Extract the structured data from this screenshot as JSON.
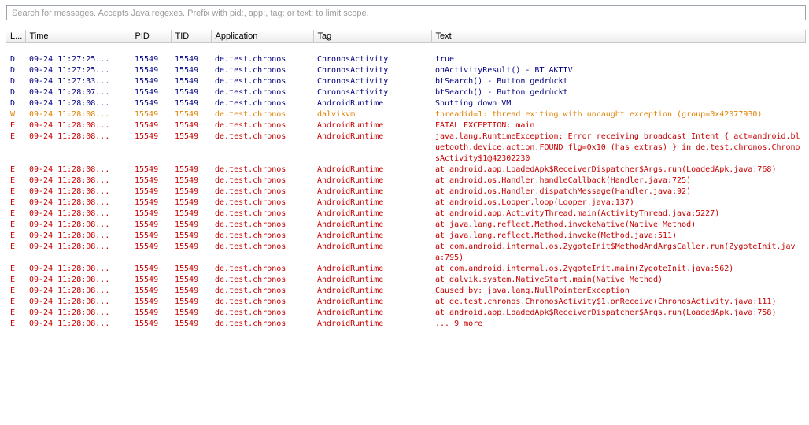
{
  "search": {
    "placeholder": "Search for messages. Accepts Java regexes. Prefix with pid:, app:, tag: or text: to limit scope."
  },
  "columns": {
    "level": "L...",
    "time": "Time",
    "pid": "PID",
    "tid": "TID",
    "application": "Application",
    "tag": "Tag",
    "text": "Text"
  },
  "colors": {
    "debug": "#000080",
    "warn": "#e08000",
    "error": "#c80000"
  },
  "rows": [
    {
      "level": "D",
      "time": "09-24 11:27:25...",
      "pid": "15549",
      "tid": "15549",
      "app": "de.test.chronos",
      "tag": "ChronosActivity",
      "text": "true"
    },
    {
      "level": "D",
      "time": "09-24 11:27:25...",
      "pid": "15549",
      "tid": "15549",
      "app": "de.test.chronos",
      "tag": "ChronosActivity",
      "text": "onActivityResult() - BT AKTIV"
    },
    {
      "level": "D",
      "time": "09-24 11:27:33...",
      "pid": "15549",
      "tid": "15549",
      "app": "de.test.chronos",
      "tag": "ChronosActivity",
      "text": "btSearch() - Button gedrückt"
    },
    {
      "level": "D",
      "time": "09-24 11:28:07...",
      "pid": "15549",
      "tid": "15549",
      "app": "de.test.chronos",
      "tag": "ChronosActivity",
      "text": "btSearch() - Button gedrückt"
    },
    {
      "level": "D",
      "time": "09-24 11:28:08...",
      "pid": "15549",
      "tid": "15549",
      "app": "de.test.chronos",
      "tag": "AndroidRuntime",
      "text": "Shutting down VM"
    },
    {
      "level": "W",
      "time": "09-24 11:28:08...",
      "pid": "15549",
      "tid": "15549",
      "app": "de.test.chronos",
      "tag": "dalvikvm",
      "text": "threadid=1: thread exiting with uncaught exception (group=0x42077930)"
    },
    {
      "level": "E",
      "time": "09-24 11:28:08...",
      "pid": "15549",
      "tid": "15549",
      "app": "de.test.chronos",
      "tag": "AndroidRuntime",
      "text": "FATAL EXCEPTION: main"
    },
    {
      "level": "E",
      "time": "09-24 11:28:08...",
      "pid": "15549",
      "tid": "15549",
      "app": "de.test.chronos",
      "tag": "AndroidRuntime",
      "text": "java.lang.RuntimeException: Error receiving broadcast Intent { act=android.bluetooth.device.action.FOUND flg=0x10 (has extras) } in de.test.chronos.ChronosActivity$1@42302230"
    },
    {
      "level": "E",
      "time": "09-24 11:28:08...",
      "pid": "15549",
      "tid": "15549",
      "app": "de.test.chronos",
      "tag": "AndroidRuntime",
      "text": "at android.app.LoadedApk$ReceiverDispatcher$Args.run(LoadedApk.java:768)"
    },
    {
      "level": "E",
      "time": "09-24 11:28:08...",
      "pid": "15549",
      "tid": "15549",
      "app": "de.test.chronos",
      "tag": "AndroidRuntime",
      "text": "at android.os.Handler.handleCallback(Handler.java:725)"
    },
    {
      "level": "E",
      "time": "09-24 11:28:08...",
      "pid": "15549",
      "tid": "15549",
      "app": "de.test.chronos",
      "tag": "AndroidRuntime",
      "text": "at android.os.Handler.dispatchMessage(Handler.java:92)"
    },
    {
      "level": "E",
      "time": "09-24 11:28:08...",
      "pid": "15549",
      "tid": "15549",
      "app": "de.test.chronos",
      "tag": "AndroidRuntime",
      "text": "at android.os.Looper.loop(Looper.java:137)"
    },
    {
      "level": "E",
      "time": "09-24 11:28:08...",
      "pid": "15549",
      "tid": "15549",
      "app": "de.test.chronos",
      "tag": "AndroidRuntime",
      "text": "at android.app.ActivityThread.main(ActivityThread.java:5227)"
    },
    {
      "level": "E",
      "time": "09-24 11:28:08...",
      "pid": "15549",
      "tid": "15549",
      "app": "de.test.chronos",
      "tag": "AndroidRuntime",
      "text": "at java.lang.reflect.Method.invokeNative(Native Method)"
    },
    {
      "level": "E",
      "time": "09-24 11:28:08...",
      "pid": "15549",
      "tid": "15549",
      "app": "de.test.chronos",
      "tag": "AndroidRuntime",
      "text": "at java.lang.reflect.Method.invoke(Method.java:511)"
    },
    {
      "level": "E",
      "time": "09-24 11:28:08...",
      "pid": "15549",
      "tid": "15549",
      "app": "de.test.chronos",
      "tag": "AndroidRuntime",
      "text": "at com.android.internal.os.ZygoteInit$MethodAndArgsCaller.run(ZygoteInit.java:795)"
    },
    {
      "level": "E",
      "time": "09-24 11:28:08...",
      "pid": "15549",
      "tid": "15549",
      "app": "de.test.chronos",
      "tag": "AndroidRuntime",
      "text": "at com.android.internal.os.ZygoteInit.main(ZygoteInit.java:562)"
    },
    {
      "level": "E",
      "time": "09-24 11:28:08...",
      "pid": "15549",
      "tid": "15549",
      "app": "de.test.chronos",
      "tag": "AndroidRuntime",
      "text": "at dalvik.system.NativeStart.main(Native Method)"
    },
    {
      "level": "E",
      "time": "09-24 11:28:08...",
      "pid": "15549",
      "tid": "15549",
      "app": "de.test.chronos",
      "tag": "AndroidRuntime",
      "text": "Caused by: java.lang.NullPointerException"
    },
    {
      "level": "E",
      "time": "09-24 11:28:08...",
      "pid": "15549",
      "tid": "15549",
      "app": "de.test.chronos",
      "tag": "AndroidRuntime",
      "text": "at de.test.chronos.ChronosActivity$1.onReceive(ChronosActivity.java:111)"
    },
    {
      "level": "E",
      "time": "09-24 11:28:08...",
      "pid": "15549",
      "tid": "15549",
      "app": "de.test.chronos",
      "tag": "AndroidRuntime",
      "text": "at android.app.LoadedApk$ReceiverDispatcher$Args.run(LoadedApk.java:758)"
    },
    {
      "level": "E",
      "time": "09-24 11:28:08...",
      "pid": "15549",
      "tid": "15549",
      "app": "de.test.chronos",
      "tag": "AndroidRuntime",
      "text": "... 9 more"
    }
  ]
}
